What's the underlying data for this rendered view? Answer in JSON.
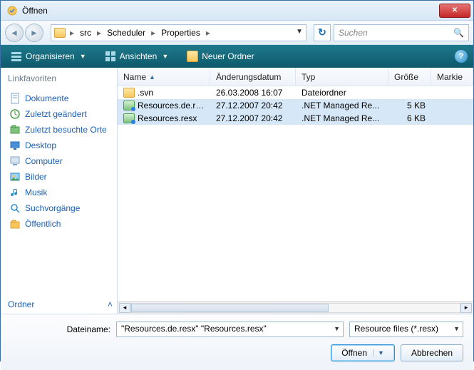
{
  "window": {
    "title": "Öffnen"
  },
  "breadcrumb": {
    "items": [
      "src",
      "Scheduler",
      "Properties"
    ]
  },
  "search": {
    "placeholder": "Suchen"
  },
  "toolbar": {
    "organize": "Organisieren",
    "views": "Ansichten",
    "new_folder": "Neuer Ordner"
  },
  "sidebar": {
    "title": "Linkfavoriten",
    "items": [
      {
        "label": "Dokumente",
        "icon": "documents-icon"
      },
      {
        "label": "Zuletzt geändert",
        "icon": "recent-changed-icon"
      },
      {
        "label": "Zuletzt besuchte Orte",
        "icon": "recent-places-icon"
      },
      {
        "label": "Desktop",
        "icon": "desktop-icon"
      },
      {
        "label": "Computer",
        "icon": "computer-icon"
      },
      {
        "label": "Bilder",
        "icon": "pictures-icon"
      },
      {
        "label": "Musik",
        "icon": "music-icon"
      },
      {
        "label": "Suchvorgänge",
        "icon": "searches-icon"
      },
      {
        "label": "Öffentlich",
        "icon": "public-icon"
      }
    ],
    "folders_label": "Ordner"
  },
  "columns": {
    "name": "Name",
    "modified": "Änderungsdatum",
    "type": "Typ",
    "size": "Größe",
    "marked": "Markie"
  },
  "files": [
    {
      "name": ".svn",
      "modified": "26.03.2008 16:07",
      "type": "Dateiordner",
      "size": "",
      "icon": "folder",
      "selected": false
    },
    {
      "name": "Resources.de.resx",
      "modified": "27.12.2007 20:42",
      "type": ".NET Managed Re...",
      "size": "5 KB",
      "icon": "resx",
      "selected": true
    },
    {
      "name": "Resources.resx",
      "modified": "27.12.2007 20:42",
      "type": ".NET Managed Re...",
      "size": "6 KB",
      "icon": "resx",
      "selected": true
    }
  ],
  "footer": {
    "filename_label": "Dateiname:",
    "filename_value": "\"Resources.de.resx\" \"Resources.resx\"",
    "filter_value": "Resource files (*.resx)",
    "open_label": "Öffnen",
    "cancel_label": "Abbrechen"
  }
}
